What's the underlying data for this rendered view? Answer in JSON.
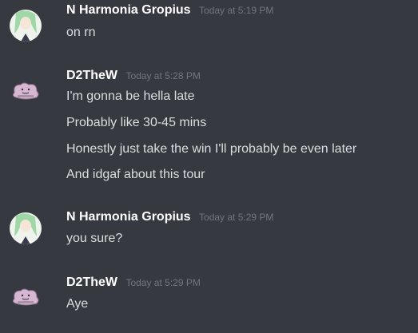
{
  "messages": [
    {
      "author": "N Harmonia Gropius",
      "timestamp": "Today at 5:19 PM",
      "avatar": "harmonia-avatar",
      "lines": [
        "on rn"
      ]
    },
    {
      "author": "D2TheW",
      "timestamp": "Today at 5:28 PM",
      "avatar": "ditto-avatar",
      "lines": [
        "I'm gonna be hella late",
        "Probably like 30-45 mins",
        "Honestly just take the win I'll probably be even later",
        "And idgaf about this tour"
      ]
    },
    {
      "author": "N Harmonia Gropius",
      "timestamp": "Today at 5:29 PM",
      "avatar": "harmonia-avatar",
      "lines": [
        "you sure?"
      ]
    },
    {
      "author": "D2TheW",
      "timestamp": "Today at 5:29 PM",
      "avatar": "ditto-avatar",
      "lines": [
        "Aye"
      ]
    }
  ],
  "colors": {
    "background": "#36393f",
    "username": "#ffffff",
    "timestamp": "#72767d",
    "text": "#dcddde"
  }
}
